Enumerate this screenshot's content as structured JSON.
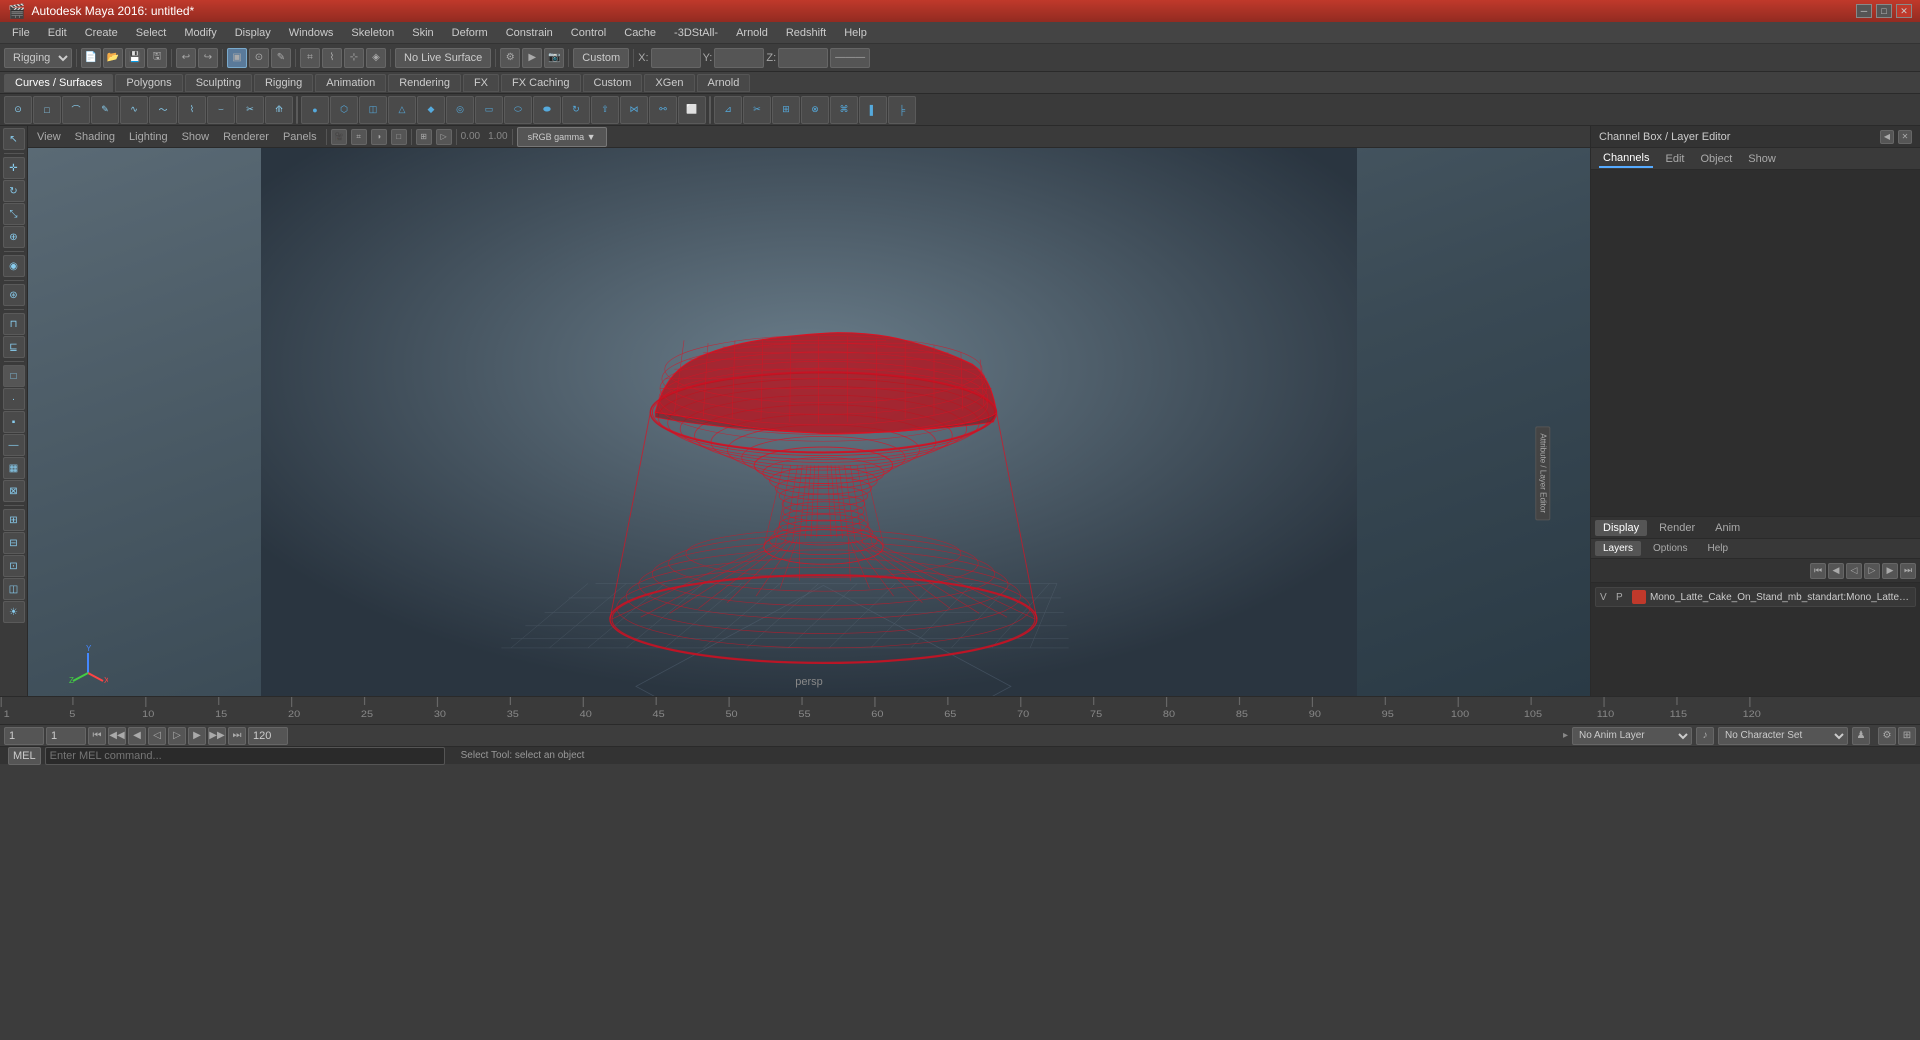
{
  "titlebar": {
    "title": "Autodesk Maya 2016: untitled*",
    "minimize": "─",
    "maximize": "□",
    "close": "✕"
  },
  "menubar": {
    "items": [
      "File",
      "Edit",
      "Create",
      "Select",
      "Modify",
      "Display",
      "Windows",
      "Skeleton",
      "Skin",
      "Deform",
      "Constrain",
      "Control",
      "Cache",
      "-3DStAll-",
      "Arnold",
      "Redshift",
      "Help"
    ]
  },
  "toolbar1": {
    "mode_select": "Rigging",
    "no_live_surface": "No Live Surface",
    "custom": "Custom",
    "x_label": "X:",
    "y_label": "Y:",
    "z_label": "Z:",
    "coord_x": "",
    "coord_y": "",
    "coord_z": ""
  },
  "shelf": {
    "tabs": [
      "Curves / Surfaces",
      "Polygons",
      "Sculpting",
      "Rigging",
      "Animation",
      "Rendering",
      "FX",
      "FX Caching",
      "Custom",
      "XGen",
      "Arnold"
    ]
  },
  "viewport": {
    "menus": [
      "View",
      "Shading",
      "Lighting",
      "Show",
      "Renderer",
      "Panels"
    ],
    "label": "persp",
    "gamma_label": "sRGB gamma",
    "coord_value": "0.00",
    "scale_value": "1.00"
  },
  "right_panel": {
    "header_title": "Channel Box / Layer Editor",
    "tabs": [
      "Channels",
      "Edit",
      "Object",
      "Show"
    ],
    "attr_tab_label": "Attribute / Layer Editor"
  },
  "right_panel_bottom": {
    "tabs": [
      "Display",
      "Render",
      "Anim"
    ],
    "sub_tabs": [
      "Layers",
      "Options",
      "Help"
    ],
    "active_tab": "Display",
    "active_sub": "Layers",
    "layer": {
      "vp": "V",
      "p": "P",
      "color": "#c0392b",
      "name": "Mono_Latte_Cake_On_Stand_mb_standart:Mono_Latte_C"
    },
    "playback_btns": {
      "prev_key": "⏮",
      "prev_frame": "◀",
      "play_back": "◁",
      "play_fwd": "▷",
      "next_frame": "▶",
      "next_key": "⏭"
    }
  },
  "timeline": {
    "start": 1,
    "end": 120,
    "current": 1,
    "marks": [
      1,
      5,
      10,
      15,
      20,
      25,
      30,
      35,
      40,
      45,
      50,
      55,
      60,
      65,
      70,
      75,
      80,
      85,
      90,
      95,
      100,
      105,
      110,
      115,
      120
    ],
    "anim_start": 1,
    "anim_end": 120,
    "playback_start": 1,
    "playback_end": 120
  },
  "playback_bar": {
    "current_frame": "1",
    "start_frame": "1",
    "loop_btn": "↺",
    "end_frame": "120",
    "anim_layer": "No Anim Layer",
    "character_set": "No Character Set"
  },
  "help_bar": {
    "mel_label": "MEL",
    "status_text": "Select Tool: select an object"
  },
  "status_icons": {
    "anim_layer_icon": "♪",
    "char_set_icon": "♟"
  }
}
